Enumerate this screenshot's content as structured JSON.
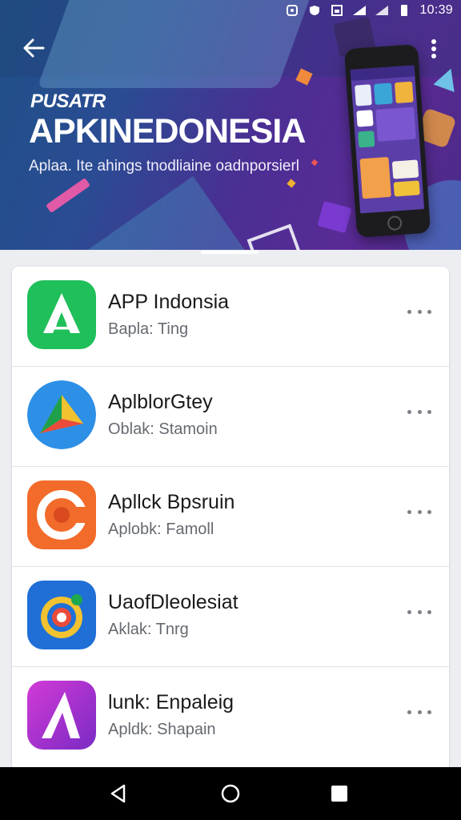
{
  "status_bar": {
    "time": "10:39",
    "icons": [
      "notification-icon",
      "vpn-icon",
      "screenshot-icon",
      "signal-icon",
      "signal-icon",
      "battery-icon"
    ]
  },
  "header": {
    "kicker": "PUSATR",
    "title": "APKINEDONESIA",
    "subtitle": "Aplaa. Ite ahings tnodliaine oadnporsierl",
    "back_icon": "arrow-left-icon",
    "menu_icon": "more-vertical-icon"
  },
  "apps": [
    {
      "name": "APP Indonsia",
      "subtitle": "Bapla: Ting",
      "icon": "green-a-icon",
      "color": "#1fbf5a"
    },
    {
      "name": "AplblorGtey",
      "subtitle": "Oblak: Stamoin",
      "icon": "play-triangle-icon",
      "color": "#2d8fe6"
    },
    {
      "name": "Apllck Bpsruin",
      "subtitle": "Aplobk: Famoll",
      "icon": "orange-c-icon",
      "color": "#f26b2a"
    },
    {
      "name": "UaofDleolesiat",
      "subtitle": "Aklak: Tnrg",
      "icon": "blue-camera-icon",
      "color": "#1f6fd6"
    },
    {
      "name": "lunk: Enpaleig",
      "subtitle": "Apldk: Shapain",
      "icon": "purple-a-icon",
      "color": "#b42fc4"
    }
  ],
  "navbar": {
    "back_icon": "nav-back-icon",
    "home_icon": "nav-home-icon",
    "recents_icon": "nav-recents-icon"
  }
}
